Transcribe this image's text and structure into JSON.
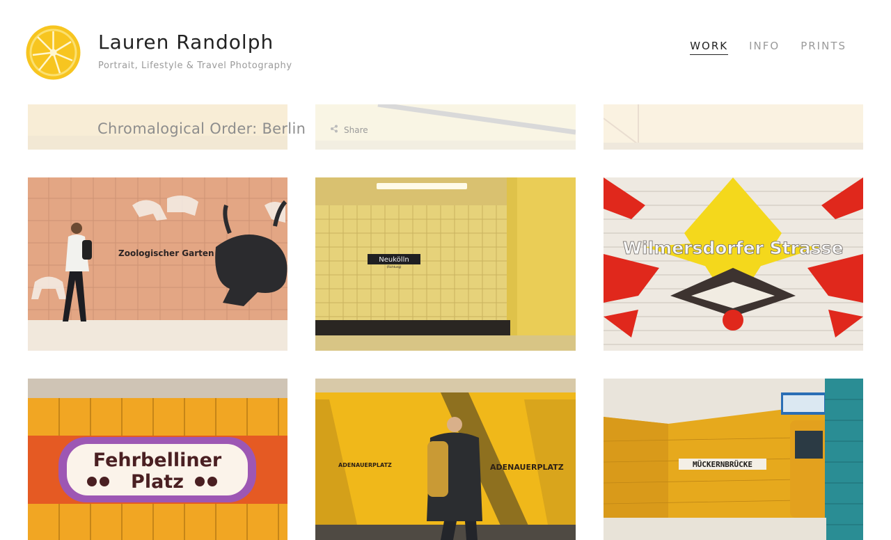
{
  "site": {
    "title": "Lauren Randolph",
    "tagline": "Portrait, Lifestyle & Travel Photography",
    "logo_icon": "lemon-slice-icon"
  },
  "nav": {
    "items": [
      {
        "label": "WORK",
        "active": true
      },
      {
        "label": "INFO",
        "active": false
      },
      {
        "label": "PRINTS",
        "active": false
      }
    ]
  },
  "gallery": {
    "title": "Chromalogical Order: Berlin",
    "share_label": "Share",
    "share_icon": "share-icon"
  },
  "photos": [
    {
      "sign": "Zoologischer Garten"
    },
    {
      "sign": "Neukölln",
      "subsign": "(Richtung)"
    },
    {
      "sign": "Wilmersdorfer Strasse"
    },
    {
      "sign_line1": "Fehrbelliner",
      "sign_line2": "Platz"
    },
    {
      "sign": "ADENAUERPLATZ"
    },
    {
      "sign": "MÜCKERNBRÜCKE"
    }
  ],
  "colors": {
    "accent_yellow": "#f7c520",
    "text_dark": "#222222",
    "text_muted": "#9a9a9a"
  }
}
